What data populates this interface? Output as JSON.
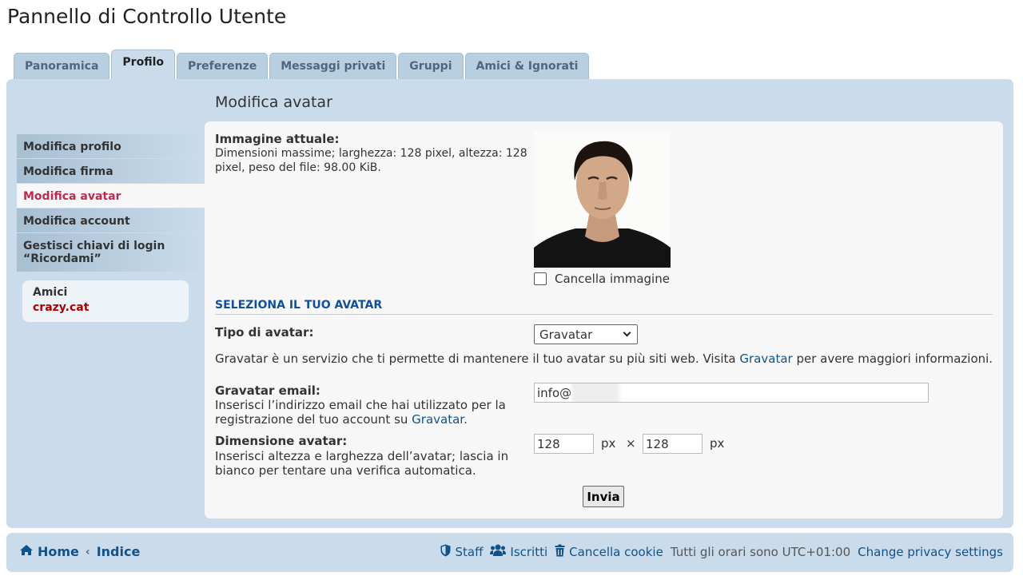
{
  "page": {
    "title": "Pannello di Controllo Utente"
  },
  "tabs": [
    {
      "label": "Panoramica"
    },
    {
      "label": "Profilo"
    },
    {
      "label": "Preferenze"
    },
    {
      "label": "Messaggi privati"
    },
    {
      "label": "Gruppi"
    },
    {
      "label": "Amici & Ignorati"
    }
  ],
  "sidebar": {
    "items": [
      {
        "label": "Modifica profilo"
      },
      {
        "label": "Modifica firma"
      },
      {
        "label": "Modifica avatar"
      },
      {
        "label": "Modifica account"
      },
      {
        "label": "Gestisci chiavi di login “Ricordami”"
      }
    ]
  },
  "friends": {
    "title": "Amici",
    "name": "crazy.cat"
  },
  "main": {
    "section_title": "Modifica avatar",
    "current_label": "Immagine attuale:",
    "current_desc": "Dimensioni massime; larghezza: 128 pixel, altezza: 128 pixel, peso del file: 98.00 KiB.",
    "delete_label": "Cancella immagine",
    "select_heading": "SELEZIONA IL TUO AVATAR",
    "avatar_type_label": "Tipo di avatar:",
    "avatar_type_value": "Gravatar",
    "gravatar_info_pre": "Gravatar è un servizio che ti permette di mantenere il tuo avatar su più siti web. Visita ",
    "gravatar_info_link": "Gravatar",
    "gravatar_info_post": " per avere maggiori informazioni.",
    "email_label": "Gravatar email:",
    "email_desc_pre": "Inserisci l’indirizzo email che hai utilizzato per la registrazione del tuo account su ",
    "email_desc_link": "Gravatar",
    "email_desc_post": ".",
    "email_value": "info@",
    "size_label": "Dimensione avatar:",
    "size_desc": "Inserisci altezza e larghezza dell’avatar; lascia in bianco per tentare una verifica automatica.",
    "width_value": "128",
    "height_value": "128",
    "unit": "px",
    "times": "×",
    "submit_label": "Invia"
  },
  "footer": {
    "home": "Home",
    "separator": "‹",
    "index": "Indice",
    "staff": "Staff",
    "members": "Iscritti",
    "cookies": "Cancella cookie",
    "timezone": "Tutti gli orari sono UTC+01:00",
    "privacy": "Change privacy settings"
  },
  "icons": {
    "home": "home-icon",
    "staff": "shield-icon",
    "members": "users-icon",
    "cookies": "trash-icon"
  },
  "colors": {
    "panel_bg": "#cadceb",
    "link": "#105289",
    "active_menu": "#bc2a4d",
    "friend_name": "#aa0000"
  }
}
